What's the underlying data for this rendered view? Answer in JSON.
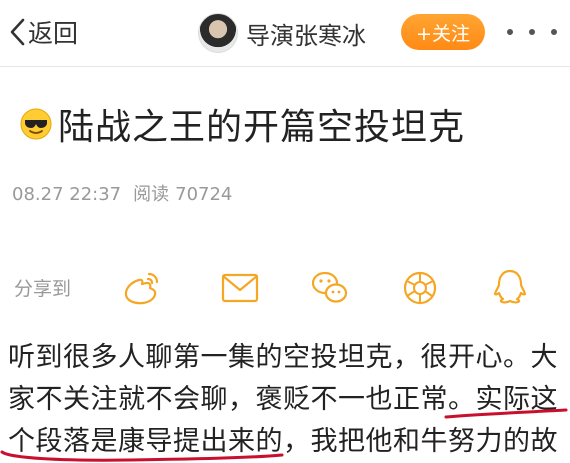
{
  "header": {
    "back_label": "返回",
    "author_name": "导演张寒冰",
    "follow_label": "+关注"
  },
  "article": {
    "title": "陆战之王的开篇空投坦克",
    "date": "08.27 22:37",
    "read_label": "阅读",
    "read_count": "70724"
  },
  "share": {
    "label": "分享到",
    "targets": [
      "weibo-icon",
      "mail-icon",
      "wechat-icon",
      "moments-icon",
      "qq-icon"
    ]
  },
  "body": {
    "lines": [
      "听到很多人聊第一集的空投坦克，很开心。大",
      "家不关注就不会聊，褒贬不一也正常。实际这",
      "个段落是康导提出来的，我把他和牛努力的故"
    ]
  },
  "colors": {
    "accent": "#ff8a14",
    "share_icons": "#f5a623",
    "annotation": "#c8102e"
  }
}
